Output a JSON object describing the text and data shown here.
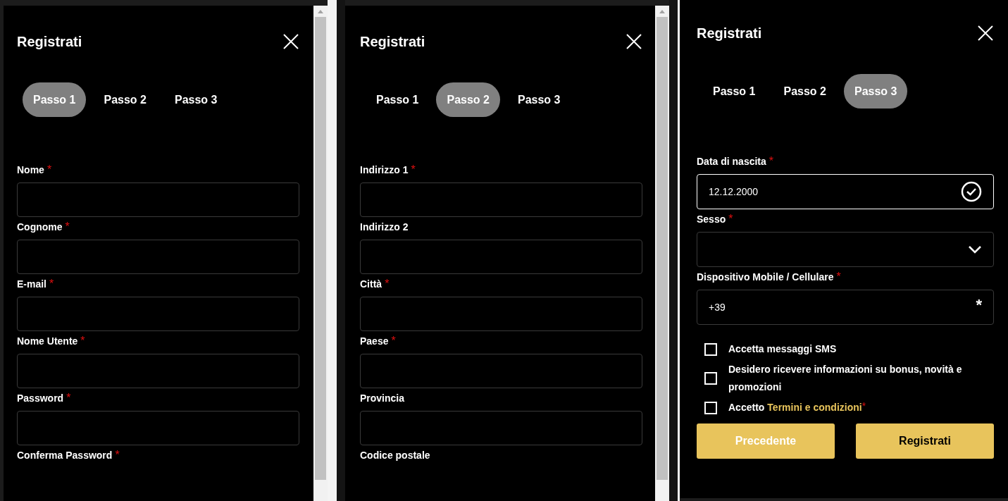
{
  "panels": [
    {
      "title": "Registrati",
      "scrollbar": true,
      "steps": [
        {
          "label": "Passo 1",
          "selected": true
        },
        {
          "label": "Passo 2",
          "selected": false
        },
        {
          "label": "Passo 3",
          "selected": false
        }
      ],
      "fields": [
        {
          "label": "Nome",
          "required": true,
          "kind": "text"
        },
        {
          "label": "Cognome",
          "required": true,
          "kind": "text"
        },
        {
          "label": "E-mail",
          "required": true,
          "kind": "text"
        },
        {
          "label": "Nome Utente",
          "required": true,
          "kind": "text"
        },
        {
          "label": "Password",
          "required": true,
          "kind": "text"
        },
        {
          "label": "Conferma Password",
          "required": true,
          "kind": "label_only"
        }
      ]
    },
    {
      "title": "Registrati",
      "scrollbar": true,
      "steps": [
        {
          "label": "Passo 1",
          "selected": false
        },
        {
          "label": "Passo 2",
          "selected": true
        },
        {
          "label": "Passo 3",
          "selected": false
        }
      ],
      "fields": [
        {
          "label": "Indirizzo 1",
          "required": true,
          "kind": "text"
        },
        {
          "label": "Indirizzo 2",
          "required": false,
          "kind": "text"
        },
        {
          "label": "Città",
          "required": true,
          "kind": "text"
        },
        {
          "label": "Paese",
          "required": true,
          "kind": "text"
        },
        {
          "label": "Provincia",
          "required": false,
          "kind": "text"
        },
        {
          "label": "Codice postale",
          "required": false,
          "kind": "label_only"
        }
      ]
    },
    {
      "title": "Registrati",
      "scrollbar": false,
      "steps": [
        {
          "label": "Passo 1",
          "selected": false
        },
        {
          "label": "Passo 2",
          "selected": false
        },
        {
          "label": "Passo 3",
          "selected": true
        }
      ],
      "fields": [
        {
          "label": "Data di nascita",
          "required": true,
          "kind": "date",
          "value": "12.12.2000"
        },
        {
          "label": "Sesso",
          "required": true,
          "kind": "select"
        },
        {
          "label": "Dispositivo Mobile / Cellulare",
          "required": true,
          "kind": "phone",
          "value": "+39",
          "suffix": "*"
        }
      ],
      "checkboxes": [
        {
          "label": "Accetta messaggi SMS",
          "checked": false,
          "required": false
        },
        {
          "label": "Desidero ricevere informazioni su bonus, novità e promozioni",
          "checked": false,
          "required": false
        },
        {
          "label": "Accetto",
          "link": "Termini e condizioni",
          "checked": false,
          "required": true
        }
      ],
      "buttons": [
        {
          "label": "Precedente",
          "kind": "secondary"
        },
        {
          "label": "Registrati",
          "kind": "primary"
        }
      ]
    }
  ]
}
